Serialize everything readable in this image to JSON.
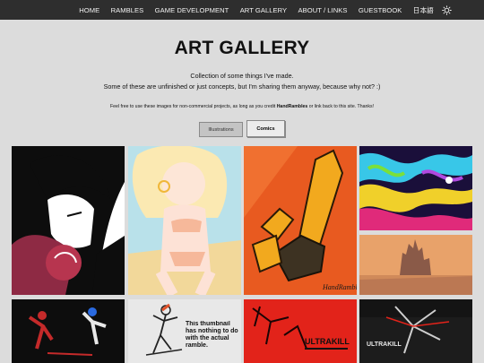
{
  "nav": {
    "items": [
      {
        "label": "HOME"
      },
      {
        "label": "RAMBLES"
      },
      {
        "label": "GAME DEVELOPMENT"
      },
      {
        "label": "ART GALLERY"
      },
      {
        "label": "ABOUT / LINKS"
      },
      {
        "label": "GUESTBOOK"
      },
      {
        "label": "日本語"
      }
    ],
    "theme_icon": "sun-icon"
  },
  "page": {
    "title": "ART GALLERY",
    "description_line1": "Collection of some things I've made.",
    "description_line2": "Some of these are unfinished or just concepts, but I'm sharing them anyway, because why not? :)",
    "notice_before": "Feel free to use these images for non-commercial projects, as long as you credit ",
    "notice_bold": "HandRambles",
    "notice_after": " or link back to this site. Thanks!"
  },
  "tabs": [
    {
      "label": "Illustrations",
      "active": false
    },
    {
      "label": "Comics",
      "active": true
    }
  ],
  "gallery": {
    "signature": "HandRambles",
    "thumb_text": "This thumbnail has nothing to do with the actual ramble.",
    "ultrakill_1": "ULTRAKILL",
    "ultrakill_2": "ULTRAKILL"
  },
  "colors": {
    "nav_bg": "#2e2e2e",
    "page_bg": "#dcdcdc",
    "accent_red": "#e2231a"
  }
}
